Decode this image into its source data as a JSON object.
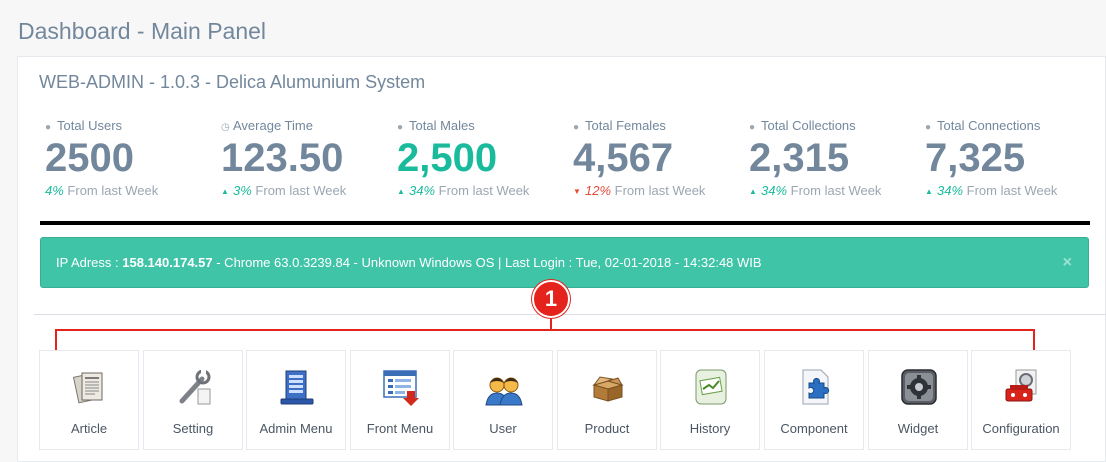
{
  "page": {
    "title": "Dashboard - Main Panel"
  },
  "panel": {
    "title": "WEB-ADMIN - 1.0.3 - Delica Alumunium System",
    "stats": [
      {
        "label": "Total Users",
        "icon": "user-icon",
        "value": "2500",
        "trend": "none",
        "pct": "4%",
        "foot": "From last Week"
      },
      {
        "label": "Average Time",
        "icon": "clock-icon",
        "value": "123.50",
        "trend": "up",
        "pct": "3%",
        "foot": "From last Week"
      },
      {
        "label": "Total Males",
        "icon": "user-icon",
        "value": "2,500",
        "trend": "up",
        "pct": "34%",
        "foot": "From last Week"
      },
      {
        "label": "Total Females",
        "icon": "user-icon",
        "value": "4,567",
        "trend": "down",
        "pct": "12%",
        "foot": "From last Week"
      },
      {
        "label": "Total Collections",
        "icon": "user-icon",
        "value": "2,315",
        "trend": "up",
        "pct": "34%",
        "foot": "From last Week"
      },
      {
        "label": "Total Connections",
        "icon": "user-icon",
        "value": "7,325",
        "trend": "up",
        "pct": "34%",
        "foot": "From last Week"
      }
    ]
  },
  "alert": {
    "ip_label": "IP Adress : ",
    "ip": "158.140.174.57",
    "details": " - Chrome 63.0.3239.84 - Unknown Windows OS | Last Login : Tue, 02-01-2018 - 14:32:48 WIB",
    "close": "×"
  },
  "annotation": {
    "number": "1"
  },
  "shortcuts": [
    {
      "label": "Article",
      "icon": "article-icon"
    },
    {
      "label": "Setting",
      "icon": "setting-icon"
    },
    {
      "label": "Admin Menu",
      "icon": "admin-menu-icon"
    },
    {
      "label": "Front Menu",
      "icon": "front-menu-icon"
    },
    {
      "label": "User",
      "icon": "user-group-icon"
    },
    {
      "label": "Product",
      "icon": "product-icon"
    },
    {
      "label": "History",
      "icon": "history-icon"
    },
    {
      "label": "Component",
      "icon": "component-icon"
    },
    {
      "label": "Widget",
      "icon": "widget-icon"
    },
    {
      "label": "Configuration",
      "icon": "configuration-icon"
    }
  ],
  "colors": {
    "accent": "#1abb9c",
    "alert_bg": "#40c4a8",
    "down": "#e74c3c",
    "annotation": "#e3231c"
  }
}
